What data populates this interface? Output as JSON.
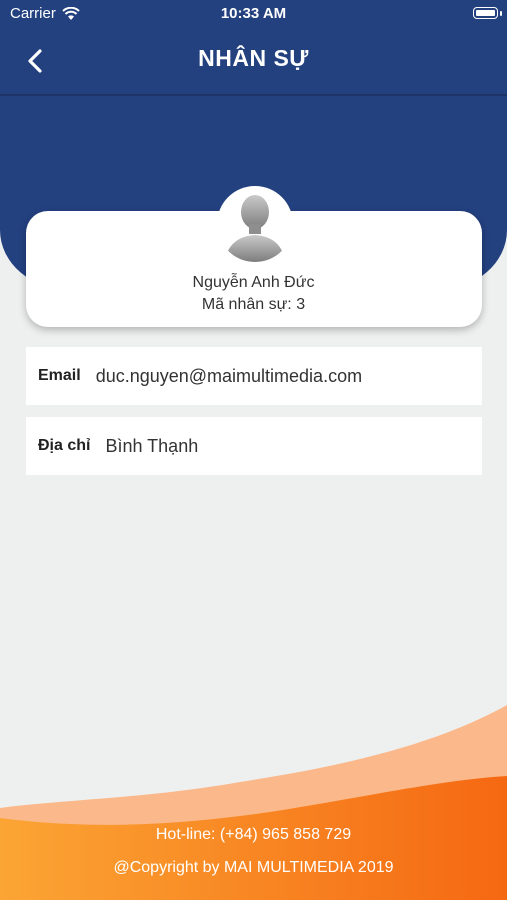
{
  "status_bar": {
    "carrier": "Carrier",
    "time": "10:33 AM"
  },
  "nav": {
    "title": "NHÂN SỰ"
  },
  "profile": {
    "name": "Nguyễn Anh Đức",
    "id_label": "Mã nhân sự:",
    "id_value": "3"
  },
  "info": [
    {
      "label": "Email",
      "value": "duc.nguyen@maimultimedia.com"
    },
    {
      "label": "Địa chỉ",
      "value": "Bình Thạnh"
    }
  ],
  "footer": {
    "hotline": "Hot-line: (+84) 965 858 729",
    "copyright": "@Copyright by MAI MULTIMEDIA 2019"
  },
  "colors": {
    "header": "#23407f",
    "background": "#eef0f0",
    "footer_orange": "#f47b20",
    "footer_light": "#fbb67c"
  }
}
